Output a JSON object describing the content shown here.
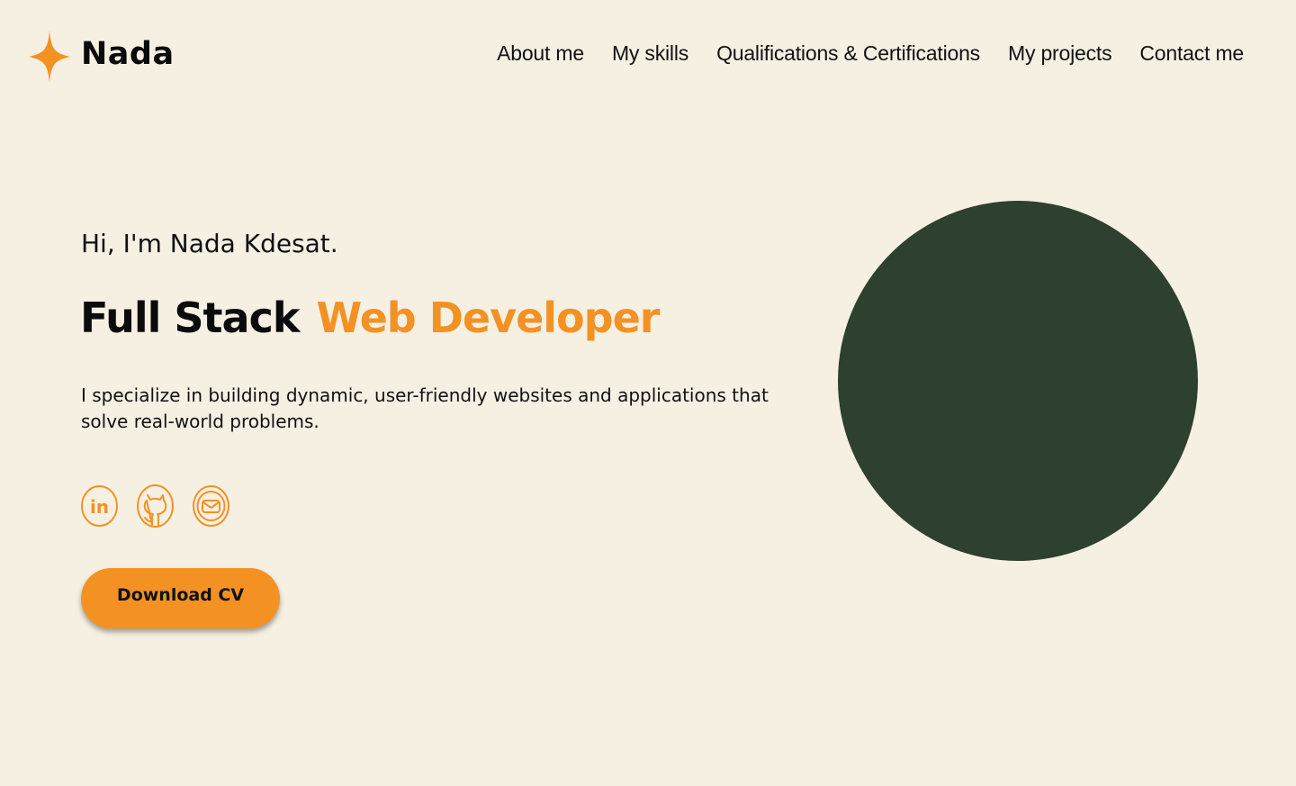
{
  "header": {
    "brand": "Nada",
    "logo_icon": "four-point-star-icon",
    "nav": [
      {
        "label": "About me"
      },
      {
        "label": "My skills"
      },
      {
        "label": "Qualifications & Certifications"
      },
      {
        "label": "My projects"
      },
      {
        "label": "Contact me"
      }
    ]
  },
  "hero": {
    "greeting": "Hi, I'm Nada Kdesat.",
    "headline_part1": "Full Stack",
    "headline_part2": "Web Developer",
    "description": "I specialize in building dynamic, user-friendly websites and applications that solve real-world problems.",
    "socials": [
      {
        "icon": "linkedin-icon"
      },
      {
        "icon": "github-icon"
      },
      {
        "icon": "email-icon"
      }
    ],
    "cta_label": "Download CV"
  },
  "colors": {
    "background": "#f6f0e3",
    "accent": "#f39223",
    "circle": "#2e402e",
    "text": "#111111"
  }
}
